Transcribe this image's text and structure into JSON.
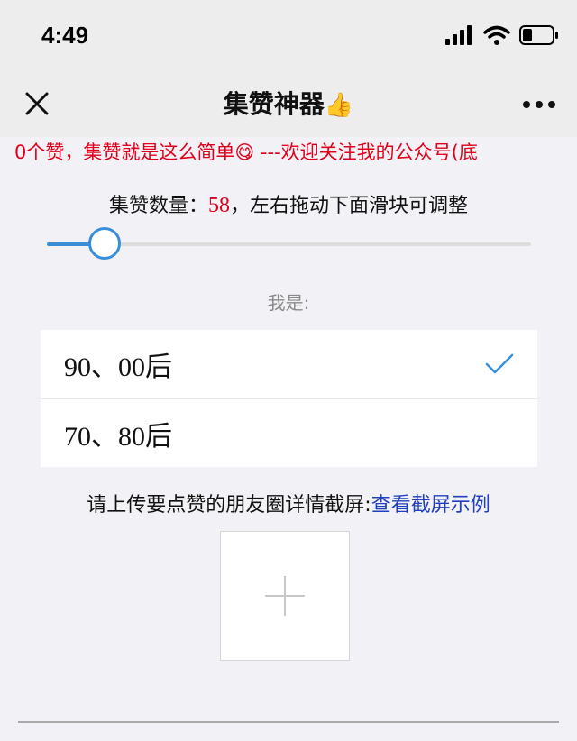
{
  "status_bar": {
    "time": "4:49",
    "icons": [
      "signal-icon",
      "wifi-icon",
      "battery-icon"
    ]
  },
  "nav": {
    "title": "集赞神器",
    "title_emoji": "👍",
    "close_icon": "close-icon",
    "more_icon": "more-icon"
  },
  "marquee": {
    "text": "0个赞，集赞就是这么简单😋 ---欢迎关注我的公众号(底"
  },
  "count": {
    "label": "集赞数量：",
    "value": "58",
    "hint": "，左右拖动下面滑块可调整",
    "slider_fraction": 0.12
  },
  "role": {
    "label": "我是:",
    "options": [
      {
        "label": "90、00后",
        "selected": true
      },
      {
        "label": "70、80后",
        "selected": false
      }
    ]
  },
  "upload": {
    "text": "请上传要点赞的朋友圈详情截屏:",
    "link": "查看截屏示例"
  },
  "colors": {
    "accent": "#3a8ed8",
    "red": "#e0001c",
    "link": "#1f3fbf",
    "background": "#f2f2f6"
  }
}
